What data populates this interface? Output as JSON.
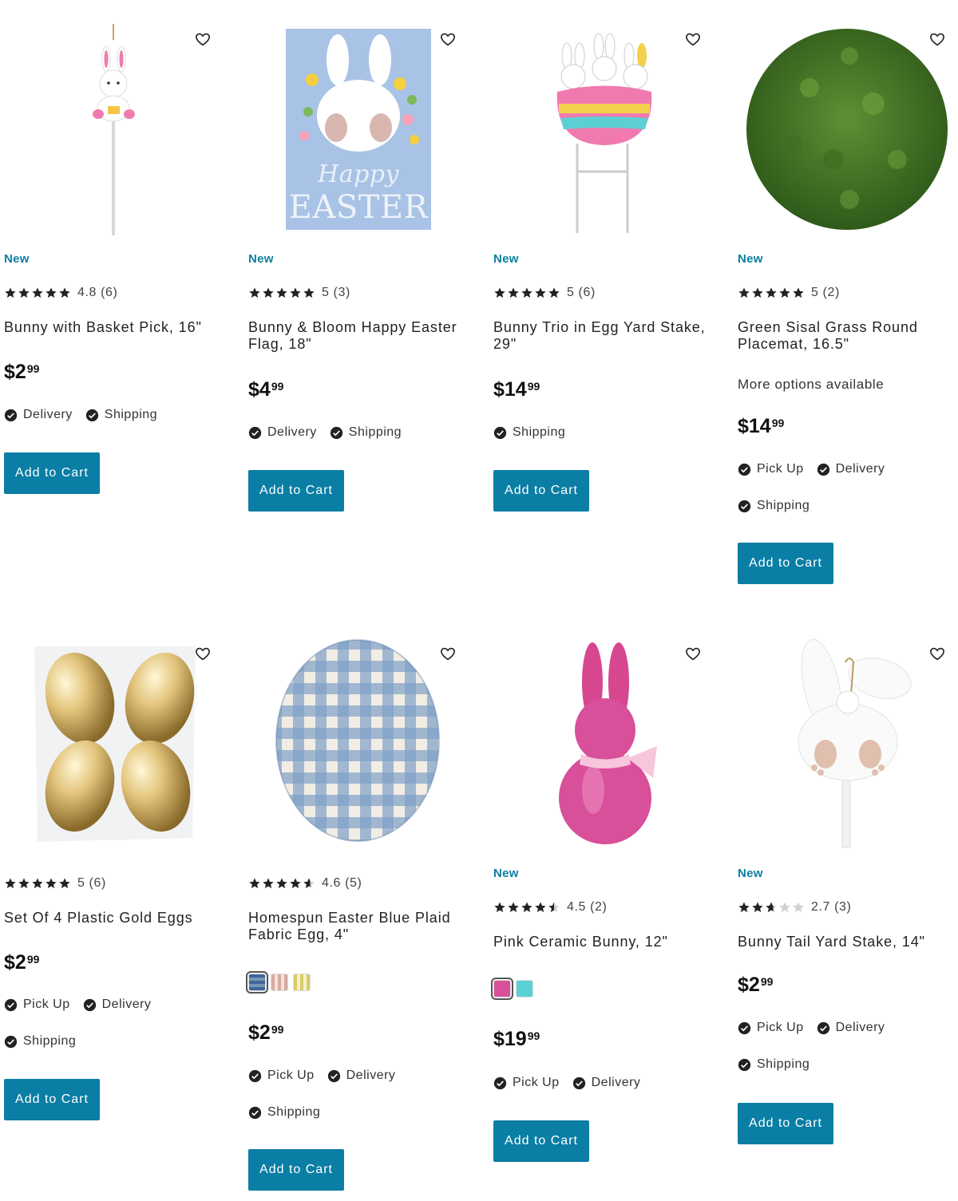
{
  "products": [
    {
      "id": "p1",
      "image_icon": "bunny-basket-pick-image",
      "badge": "New",
      "stars": 5,
      "rating_text": "4.8 (6)",
      "title": "Bunny with Basket Pick, 16\"",
      "price_whole": "2",
      "price_cents": "99",
      "fulfillment": [
        [
          "Delivery",
          "Shipping"
        ]
      ],
      "button": "Add to Cart"
    },
    {
      "id": "p2",
      "image_icon": "happy-easter-flag-image",
      "badge": "New",
      "stars": 5,
      "rating_text": "5 (3)",
      "title": "Bunny & Bloom Happy Easter Flag, 18\"",
      "price_whole": "4",
      "price_cents": "99",
      "fulfillment": [
        [
          "Delivery",
          "Shipping"
        ]
      ],
      "button": "Add to Cart"
    },
    {
      "id": "p3",
      "image_icon": "bunny-trio-egg-stake-image",
      "badge": "New",
      "stars": 5,
      "rating_text": "5 (6)",
      "title": "Bunny Trio in Egg Yard Stake, 29\"",
      "price_whole": "14",
      "price_cents": "99",
      "fulfillment": [
        [
          "Shipping"
        ]
      ],
      "button": "Add to Cart"
    },
    {
      "id": "p4",
      "image_icon": "grass-placemat-image",
      "badge": "New",
      "stars": 5,
      "rating_text": "5 (2)",
      "title": "Green Sisal Grass Round Placemat, 16.5\"",
      "options": "More options available",
      "price_whole": "14",
      "price_cents": "99",
      "fulfillment": [
        [
          "Pick Up",
          "Delivery"
        ],
        [
          "Shipping"
        ]
      ],
      "button": "Add to Cart"
    },
    {
      "id": "p5",
      "image_icon": "gold-eggs-image",
      "badge": "",
      "stars": 5,
      "rating_text": "5 (6)",
      "title": "Set Of 4 Plastic Gold Eggs",
      "price_whole": "2",
      "price_cents": "99",
      "fulfillment": [
        [
          "Pick Up",
          "Delivery"
        ],
        [
          "Shipping"
        ]
      ],
      "button": "Add to Cart"
    },
    {
      "id": "p6",
      "image_icon": "plaid-fabric-egg-image",
      "badge": "",
      "stars": 4.6,
      "rating_text": "4.6 (5)",
      "title": "Homespun Easter Blue Plaid Fabric Egg, 4\"",
      "swatches": [
        "blue-plaid",
        "pink-plaid",
        "yellow-plaid"
      ],
      "price_whole": "2",
      "price_cents": "99",
      "fulfillment": [
        [
          "Pick Up",
          "Delivery"
        ],
        [
          "Shipping"
        ]
      ],
      "button": "Add to Cart"
    },
    {
      "id": "p7",
      "image_icon": "pink-ceramic-bunny-image",
      "badge": "New",
      "stars": 4.5,
      "rating_text": "4.5 (2)",
      "title": "Pink Ceramic Bunny, 12\"",
      "swatches": [
        "#d84f9a",
        "#5ccfd4"
      ],
      "price_whole": "19",
      "price_cents": "99",
      "fulfillment": [
        [
          "Pick Up",
          "Delivery"
        ]
      ],
      "button": "Add to Cart"
    },
    {
      "id": "p8",
      "image_icon": "bunny-tail-stake-image",
      "badge": "New",
      "stars": 2.7,
      "rating_text": "2.7 (3)",
      "title": "Bunny Tail Yard Stake, 14\"",
      "price_whole": "2",
      "price_cents": "99",
      "fulfillment": [
        [
          "Pick Up",
          "Delivery"
        ],
        [
          "Shipping"
        ]
      ],
      "button": "Add to Cart"
    }
  ],
  "currency": "$",
  "colors": {
    "accent": "#0a7ea4",
    "badge": "#0b7fa0",
    "star": "#222222"
  }
}
